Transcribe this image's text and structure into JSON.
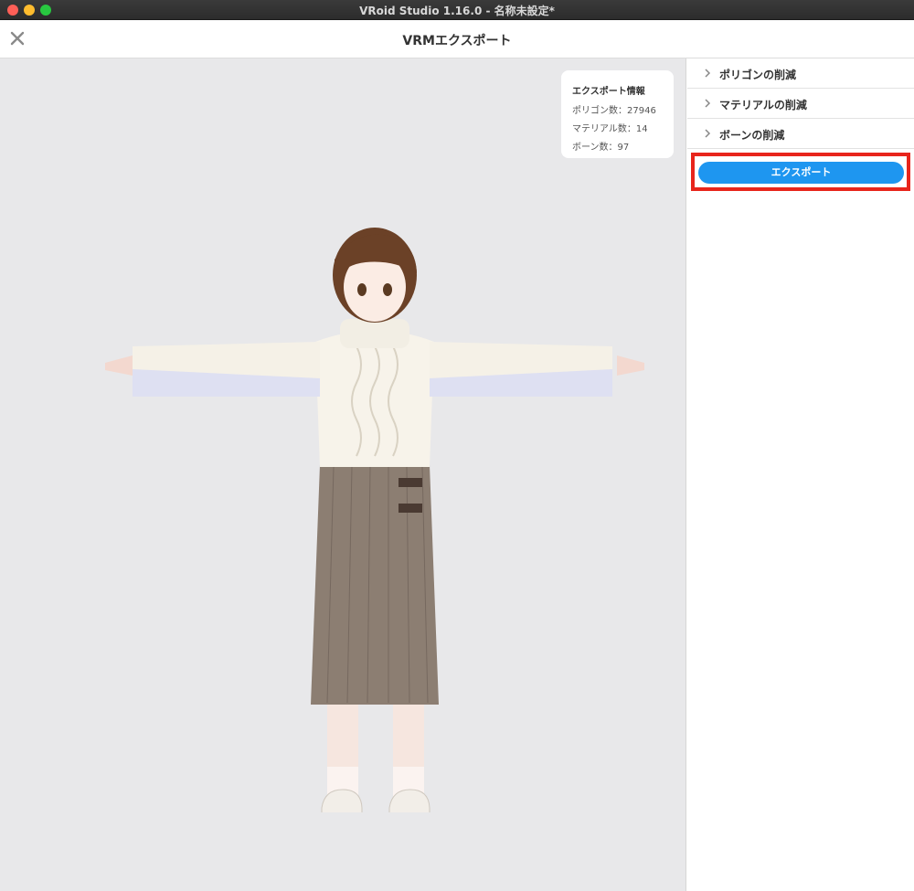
{
  "window": {
    "title": "VRoid Studio 1.16.0 - 名称未設定*"
  },
  "header": {
    "title": "VRMエクスポート"
  },
  "export_info": {
    "title": "エクスポート情報",
    "polygons": "ポリゴン数：27946",
    "materials": "マテリアル数：14",
    "bones": "ボーン数：97"
  },
  "panel": {
    "sections": [
      {
        "label": "ポリゴンの削減"
      },
      {
        "label": "マテリアルの削減"
      },
      {
        "label": "ボーンの削減"
      }
    ],
    "export_button": "エクスポート"
  },
  "colors": {
    "accent": "#1e96f0",
    "highlight": "#e8251c",
    "viewport_bg": "#e8e8ea"
  }
}
